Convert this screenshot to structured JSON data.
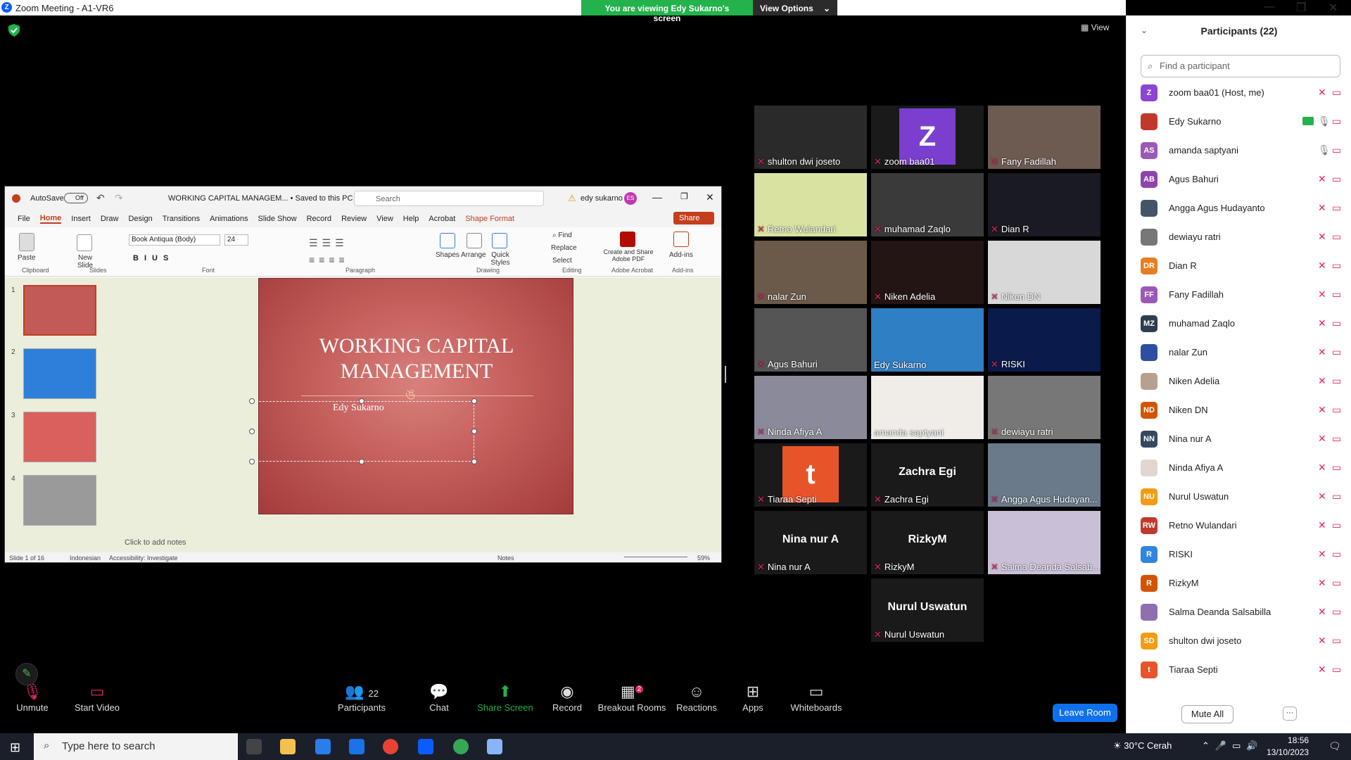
{
  "app": {
    "window_title": "Zoom Meeting - A1-VR6",
    "banner_text": "You are viewing Edy Sukarno's screen",
    "view_options": "View Options",
    "view_label": "View"
  },
  "ppt": {
    "autosave": "AutoSave",
    "autosave_state": "Off",
    "doc_title": "WORKING CAPITAL MANAGEM... • Saved to this PC",
    "search_placeholder": "Search",
    "user": "edy sukarno",
    "user_initials": "ES",
    "menus": [
      "File",
      "Home",
      "Insert",
      "Draw",
      "Design",
      "Transitions",
      "Animations",
      "Slide Show",
      "Record",
      "Review",
      "View",
      "Help",
      "Acrobat",
      "Shape Format"
    ],
    "share": "Share",
    "font_name": "Book Antiqua (Body)",
    "font_size": "24",
    "groups": {
      "clipboard": "Clipboard",
      "slides": "Slides",
      "font": "Font",
      "paragraph": "Paragraph",
      "drawing": "Drawing",
      "editing": "Editing",
      "adobe": "Adobe Acrobat",
      "addins": "Add-ins"
    },
    "buttons": {
      "paste": "Paste",
      "new_slide": "New Slide",
      "shapes": "Shapes",
      "arrange": "Arrange",
      "quick_styles": "Quick Styles",
      "find": "Find",
      "replace": "Replace",
      "select": "Select",
      "create_share": "Create and Share Adobe PDF",
      "addins": "Add-ins"
    },
    "slide_title": "WORKING CAPITAL MANAGEMENT",
    "slide_subtitle": "Edy Sukarno",
    "slide_ornament": "ঙ",
    "thumb_numbers": [
      "1",
      "2",
      "3",
      "4"
    ],
    "notes_placeholder": "Click to add notes",
    "status_slide": "Slide 1 of 16",
    "status_lang": "Indonesian",
    "status_access": "Accessibility: Investigate",
    "status_notes": "Notes",
    "zoom": "59%"
  },
  "tiles": [
    {
      "name": "shulton dwi joseto",
      "bg": "#2a2a2a"
    },
    {
      "name": "zoom baa01",
      "letter": "Z",
      "bg": "#7b3fd0"
    },
    {
      "name": "Fany Fadillah",
      "bg": "#6d5a50"
    },
    {
      "name": "Retno Wulandari",
      "bg": "#d9e2a0"
    },
    {
      "name": "muhamad Zaqlo",
      "bg": "#3a3a3a"
    },
    {
      "name": "Dian R",
      "bg": "#1a1a22"
    },
    {
      "name": "nalar Zun",
      "bg": "#6b5a4a"
    },
    {
      "name": "Niken Adelia",
      "bg": "#241515"
    },
    {
      "name": "Niken DN",
      "bg": "#d8d8d8"
    },
    {
      "name": "Agus Bahuri",
      "bg": "#555"
    },
    {
      "name": "Edy Sukarno",
      "bg": "#2e7fc4"
    },
    {
      "name": "RISKI",
      "bg": "#0a1a4a"
    },
    {
      "name": "Ninda Afiya A",
      "bg": "#8a8a9a"
    },
    {
      "name": "amanda saptyani",
      "bg": "#f0ece8"
    },
    {
      "name": "dewiayu ratri",
      "bg": "#777"
    },
    {
      "name": "Tiaraa Septi",
      "letter": "t",
      "bg": "#e8542a"
    },
    {
      "name": "Zachra Egi",
      "big": "Zachra Egi",
      "bg": "#1a1a1a"
    },
    {
      "name": "Angga Agus Hudayan...",
      "bg": "#6a7a8a"
    },
    {
      "name": "Nina nur A",
      "big": "Nina nur A",
      "bg": "#1a1a1a"
    },
    {
      "name": "RizkyM",
      "big": "RizkyM",
      "bg": "#1a1a1a"
    },
    {
      "name": "Salma Deanda Salsab...",
      "bg": "#c9c0d8"
    },
    {
      "name": "Nurul Uswatun",
      "big": "Nurul Uswatun",
      "bg": "#1a1a1a"
    }
  ],
  "panel": {
    "title": "Participants (22)",
    "search_placeholder": "Find a participant",
    "participants": [
      {
        "name": "zoom baa01 (Host, me)",
        "initials": "Z",
        "color": "#8b46d6"
      },
      {
        "name": "Edy Sukarno",
        "initials": "",
        "color": "#c0392b",
        "sharing": true
      },
      {
        "name": "amanda saptyani",
        "initials": "AS",
        "color": "#9b59b6"
      },
      {
        "name": "Agus Bahuri",
        "initials": "AB",
        "color": "#8e44ad"
      },
      {
        "name": "Angga Agus Hudayanto",
        "initials": "",
        "color": "#445566"
      },
      {
        "name": "dewiayu ratri",
        "initials": "",
        "color": "#777777"
      },
      {
        "name": "Dian R",
        "initials": "DR",
        "color": "#e67e22"
      },
      {
        "name": "Fany Fadillah",
        "initials": "FF",
        "color": "#9b59b6"
      },
      {
        "name": "muhamad Zaqlo",
        "initials": "MZ",
        "color": "#2c3e50"
      },
      {
        "name": "nalar Zun",
        "initials": "",
        "color": "#2c4fa0"
      },
      {
        "name": "Niken Adelia",
        "initials": "",
        "color": "#b8a090"
      },
      {
        "name": "Niken DN",
        "initials": "ND",
        "color": "#d35400"
      },
      {
        "name": "Nina nur A",
        "initials": "NN",
        "color": "#34495e"
      },
      {
        "name": "Ninda Afiya A",
        "initials": "",
        "color": "#e0d8d0"
      },
      {
        "name": "Nurul Uswatun",
        "initials": "NU",
        "color": "#f39c12"
      },
      {
        "name": "Retno Wulandari",
        "initials": "RW",
        "color": "#c0392b"
      },
      {
        "name": "RISKI",
        "initials": "R",
        "color": "#2e86de"
      },
      {
        "name": "RizkyM",
        "initials": "R",
        "color": "#d35400"
      },
      {
        "name": "Salma Deanda Salsabilla",
        "initials": "",
        "color": "#8e6fb0"
      },
      {
        "name": "shulton dwi joseto",
        "initials": "SD",
        "color": "#f39c12"
      },
      {
        "name": "Tiaraa Septi",
        "initials": "t",
        "color": "#e8542a"
      }
    ],
    "mute_all": "Mute All",
    "more": "···"
  },
  "toolbar": {
    "unmute": "Unmute",
    "start_video": "Start Video",
    "participants": "Participants",
    "participants_count": "22",
    "chat": "Chat",
    "share_screen": "Share Screen",
    "record": "Record",
    "breakout": "Breakout Rooms",
    "breakout_badge": "2",
    "reactions": "Reactions",
    "apps": "Apps",
    "whiteboards": "Whiteboards",
    "leave": "Leave Room"
  },
  "taskbar": {
    "search_placeholder": "Type here to search",
    "weather": "30°C Cerah",
    "time": "18:56",
    "date": "13/10/2023"
  }
}
